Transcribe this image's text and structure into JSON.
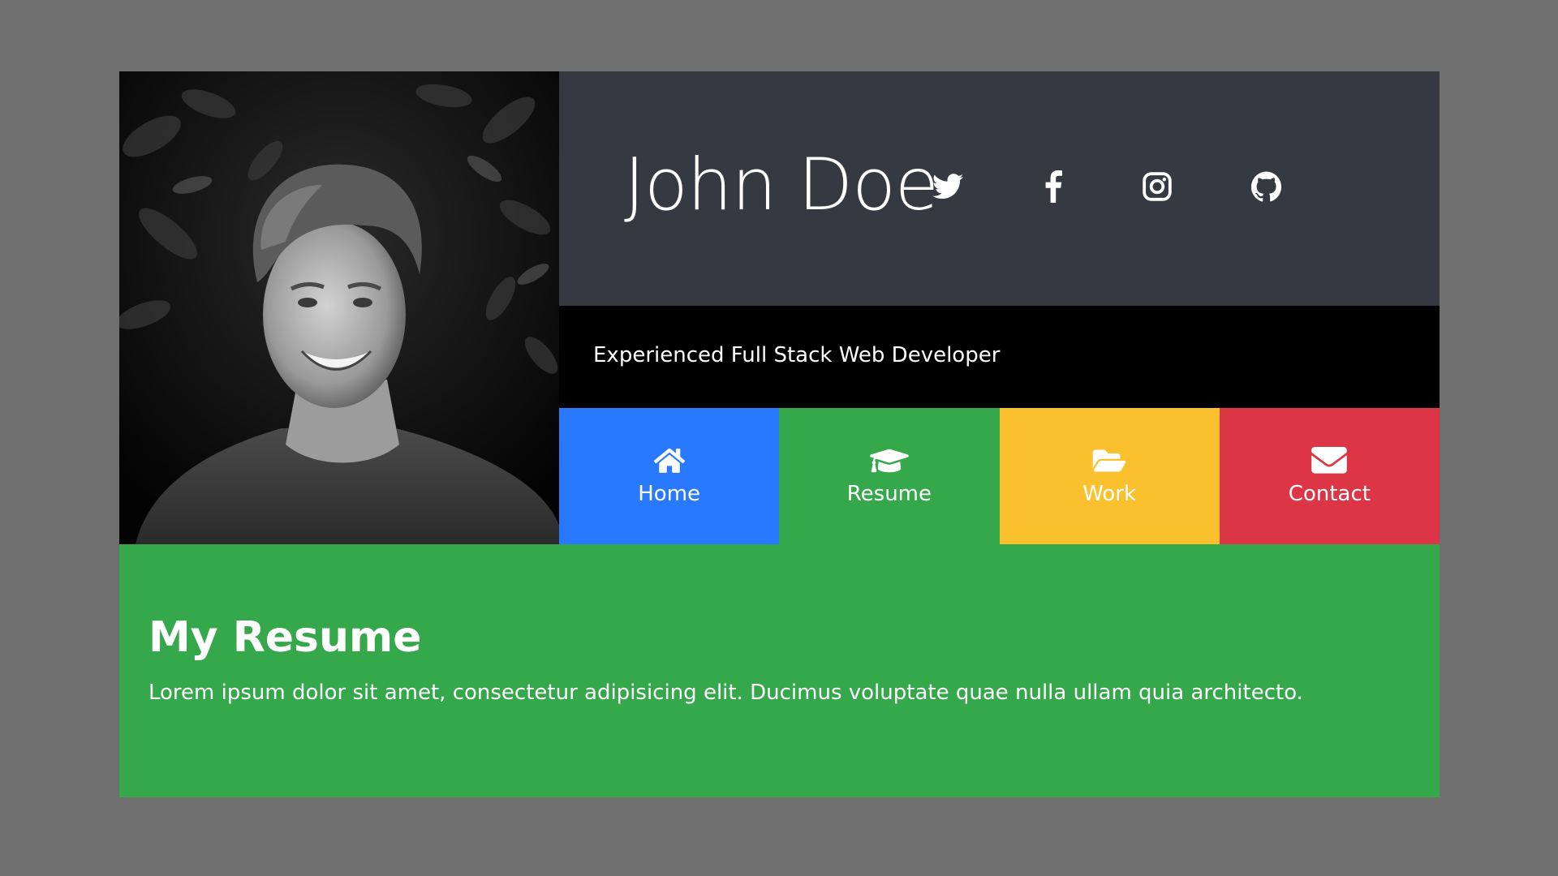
{
  "colors": {
    "page_background": "#6f6f6f",
    "header_background": "#353941",
    "tagline_background": "#000000",
    "home": "#2979ff",
    "resume": "#34a84a",
    "work": "#fbc02d",
    "contact": "#dc3545",
    "content_background": "#34a84a"
  },
  "profile": {
    "name": "John Doe",
    "tagline": "Experienced Full Stack Web Developer",
    "photo": "black-and-white portrait photo"
  },
  "social": [
    {
      "name": "twitter",
      "icon": "twitter-icon"
    },
    {
      "name": "facebook",
      "icon": "facebook-icon"
    },
    {
      "name": "instagram",
      "icon": "instagram-icon"
    },
    {
      "name": "github",
      "icon": "github-icon"
    }
  ],
  "nav": [
    {
      "label": "Home",
      "icon": "home-icon"
    },
    {
      "label": "Resume",
      "icon": "graduation-cap-icon",
      "active": true
    },
    {
      "label": "Work",
      "icon": "folder-open-icon"
    },
    {
      "label": "Contact",
      "icon": "envelope-icon"
    }
  ],
  "content": {
    "title": "My Resume",
    "body": "Lorem ipsum dolor sit amet, consectetur adipisicing elit. Ducimus voluptate quae nulla ullam quia architecto."
  }
}
